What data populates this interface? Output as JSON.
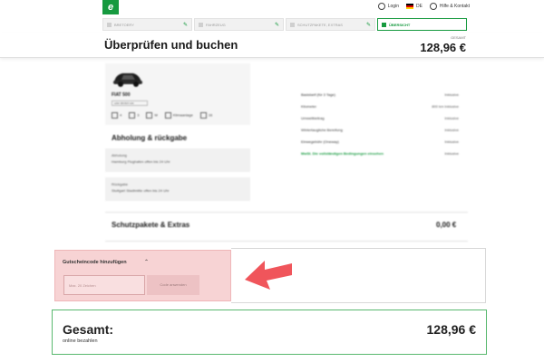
{
  "top_links": {
    "login": "Login",
    "language": "DE",
    "help": "Hilfe & Kontakt"
  },
  "steps": [
    {
      "label": "BRETOERY"
    },
    {
      "label": "FAHRZEUG"
    },
    {
      "label": "SCHUTZPAKETE, EXTRAS"
    },
    {
      "label": "ÜBERSICHT"
    }
  ],
  "header": {
    "title": "Überprüfen und buchen",
    "total_label": "GESAMT",
    "total": "128,96 €"
  },
  "car": {
    "name": "FIAT 500",
    "chip": "oder ähnlich wie",
    "features": [
      "4",
      "3",
      "M",
      "Klimaanlage",
      "16"
    ]
  },
  "prices": [
    {
      "label": "Basistarif (für 3 Tage)",
      "value": "Inklusive"
    },
    {
      "label": "Kilometer",
      "value": "800 km Inklusive"
    },
    {
      "label": "Umweltbeitrag",
      "value": "Inklusive"
    },
    {
      "label": "Wintertaugliche Bereifung",
      "value": "Inklusive"
    },
    {
      "label": "Einwegebühr (Oneway)",
      "value": "Inklusive"
    },
    {
      "label": "MwSt. Die vollständigen Bedingungen einsehen",
      "value": "Inklusive"
    }
  ],
  "pickup": {
    "title": "Abholung & rückgabe",
    "pickup_label": "Abholung",
    "pickup_value": "Hamburg Flughafen offen bis 24 Uhr",
    "return_label": "Rückgabe",
    "return_value": "Stuttgart Stadtmitte offen bis 24 Uhr"
  },
  "extras": {
    "title": "Schutzpakete & Extras",
    "amount": "0,00 €"
  },
  "coupon": {
    "title": "Gutscheincode hinzufügen",
    "placeholder": "Max. 20 Zeichen",
    "button": "Code anwenden"
  },
  "grand_total": {
    "title": "Gesamt:",
    "subtitle": "online bezahlen",
    "amount": "128,96 €"
  },
  "colors": {
    "brand_green": "#169a3f",
    "highlight_pink": "#f7d3d4",
    "arrow_red": "#f0555b"
  }
}
